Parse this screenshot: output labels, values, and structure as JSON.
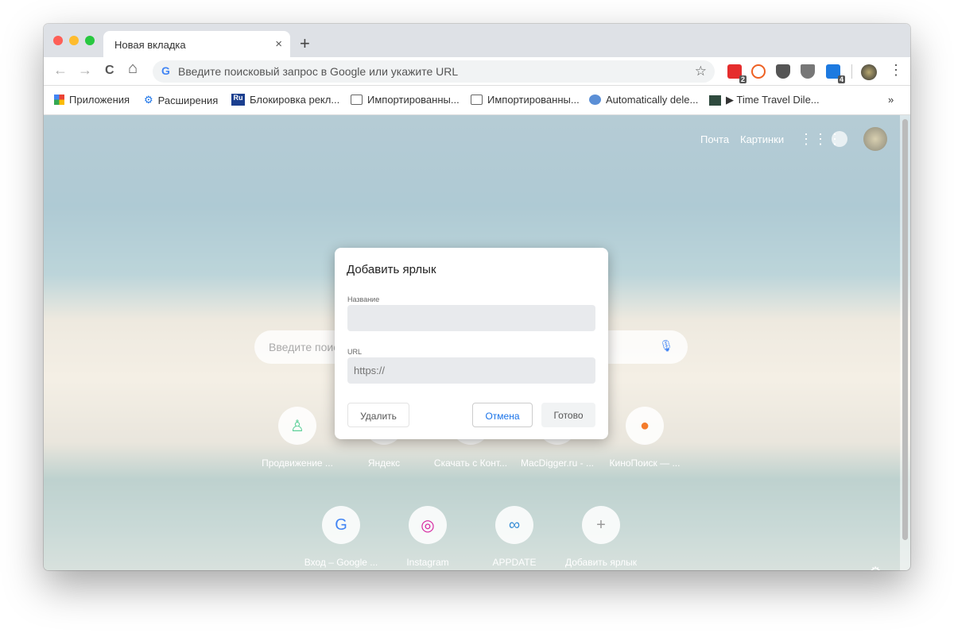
{
  "tab": {
    "title": "Новая вкладка",
    "close": "×",
    "new_tab": "+"
  },
  "toolbar": {
    "back": "←",
    "forward": "→",
    "reload": "C",
    "home": "⌂",
    "omnibox_placeholder": "Введите поисковый запрос в Google или укажите URL",
    "google_g": "G",
    "star": "☆",
    "menu": "⋮",
    "extensions": [
      {
        "name": "red-extension",
        "color": "#e52d2d",
        "badge": "2"
      },
      {
        "name": "bitly-extension",
        "color": "#ee6123",
        "badge": ""
      },
      {
        "name": "pocket-extension",
        "color": "#555555",
        "badge": ""
      },
      {
        "name": "ublock-extension",
        "color": "#777777",
        "badge": ""
      },
      {
        "name": "skype-extension",
        "color": "#1d7ae0",
        "badge": "4"
      }
    ]
  },
  "bookmarks": [
    {
      "label": "Приложения",
      "icon": "apps-grid-icon"
    },
    {
      "label": "Расширения",
      "icon": "gear-icon"
    },
    {
      "label": "Блокировка рекл...",
      "icon": "ru-icon"
    },
    {
      "label": "Импортированны...",
      "icon": "folder-icon"
    },
    {
      "label": "Импортированны...",
      "icon": "folder-icon"
    },
    {
      "label": "Automatically dele...",
      "icon": "bird-icon"
    },
    {
      "label": "▶ Time Travel Dile...",
      "icon": "thumbnail-icon"
    }
  ],
  "bookmarks_overflow": "»",
  "ntp": {
    "mail": "Почта",
    "images": "Картинки",
    "search_placeholder": "Введите поиск",
    "shortcuts_row1": [
      {
        "label": "Продвижение ...",
        "glyph": "♙",
        "color": "#5fd19a"
      },
      {
        "label": "Яндекс",
        "glyph": "",
        "color": "#999"
      },
      {
        "label": "Скачать с Конт...",
        "glyph": "",
        "color": "#999"
      },
      {
        "label": "MacDigger.ru - ...",
        "glyph": "",
        "color": "#999"
      },
      {
        "label": "КиноПоиск — ...",
        "glyph": "●",
        "color": "#f47c2c"
      }
    ],
    "shortcuts_row2": [
      {
        "label": "Вход – Google ...",
        "glyph": "G",
        "color": "#4285f4"
      },
      {
        "label": "Instagram",
        "glyph": "◎",
        "color": "#d6249f"
      },
      {
        "label": "APPDATE",
        "glyph": "∞",
        "color": "#3a8fd6"
      },
      {
        "label": "Добавить ярлык",
        "glyph": "+",
        "color": "#999"
      }
    ]
  },
  "dialog": {
    "title": "Добавить ярлык",
    "name_label": "Название",
    "name_value": "",
    "url_label": "URL",
    "url_placeholder": "https://",
    "delete": "Удалить",
    "cancel": "Отмена",
    "done": "Готово"
  }
}
